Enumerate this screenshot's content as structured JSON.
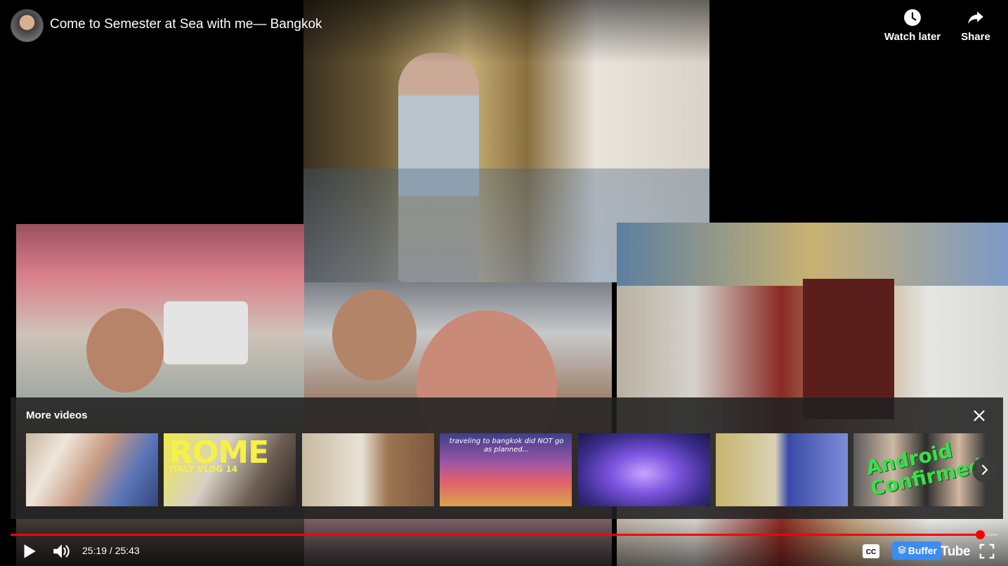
{
  "header": {
    "title": "Come to Semester at Sea with me— Bangkok",
    "watch_later_label": "Watch later",
    "share_label": "Share"
  },
  "more_videos": {
    "title": "More videos",
    "thumbnails": [
      {
        "overlay_text": ""
      },
      {
        "overlay_text": "ROME",
        "overlay_subtext": "ITALY VLOG 14"
      },
      {
        "overlay_text": ""
      },
      {
        "overlay_text": "traveling to bangkok did NOT go as planned..."
      },
      {
        "overlay_text": ""
      },
      {
        "overlay_text": ""
      },
      {
        "overlay_text": "Android Confirmed"
      }
    ]
  },
  "player": {
    "time_display": "25:19 / 25:43",
    "progress": 0.985,
    "buffer_label": "Buffer",
    "logo_text": "Tube"
  },
  "icons": {
    "watch_later": "clock-icon",
    "share": "share-arrow-icon",
    "close": "close-icon",
    "next": "chevron-right-icon",
    "play": "play-icon",
    "volume": "volume-icon",
    "captions": "cc-icon",
    "fullscreen": "fullscreen-icon"
  },
  "colors": {
    "accent": "#ff0000",
    "buffer": "#3b8cf0",
    "panel": "#212121"
  }
}
